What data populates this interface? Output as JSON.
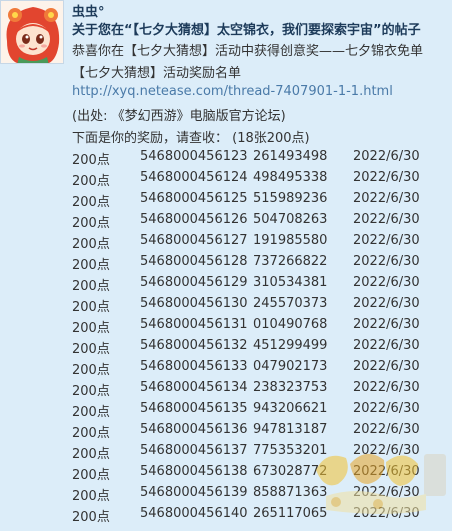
{
  "message": {
    "sender": "虫虫°",
    "title": "关于您在“【七夕大猜想】太空锦衣，我们要探索宇宙”的帖子",
    "line1": "恭喜你在【七夕大猜想】活动中获得创意奖——七夕锦衣免单",
    "line2": "【七夕大猜想】活动奖励名单",
    "link": "http://xyq.netease.com/thread-7407901-1-1.html",
    "source": "(出处: 《梦幻西游》电脑版官方论坛)",
    "reward_intro": "下面是你的奖励，请查收：  (18张200点)"
  },
  "rewards": [
    {
      "points": "200点",
      "card": "5468000456123",
      "password": "261493498",
      "date": "2022/6/30"
    },
    {
      "points": "200点",
      "card": "5468000456124",
      "password": "498495338",
      "date": "2022/6/30"
    },
    {
      "points": "200点",
      "card": "5468000456125",
      "password": "515989236",
      "date": "2022/6/30"
    },
    {
      "points": "200点",
      "card": "5468000456126",
      "password": "504708263",
      "date": "2022/6/30"
    },
    {
      "points": "200点",
      "card": "5468000456127",
      "password": "191985580",
      "date": "2022/6/30"
    },
    {
      "points": "200点",
      "card": "5468000456128",
      "password": "737266822",
      "date": "2022/6/30"
    },
    {
      "points": "200点",
      "card": "5468000456129",
      "password": "310534381",
      "date": "2022/6/30"
    },
    {
      "points": "200点",
      "card": "5468000456130",
      "password": "245570373",
      "date": "2022/6/30"
    },
    {
      "points": "200点",
      "card": "5468000456131",
      "password": "010490768",
      "date": "2022/6/30"
    },
    {
      "points": "200点",
      "card": "5468000456132",
      "password": "451299499",
      "date": "2022/6/30"
    },
    {
      "points": "200点",
      "card": "5468000456133",
      "password": "047902173",
      "date": "2022/6/30"
    },
    {
      "points": "200点",
      "card": "5468000456134",
      "password": "238323753",
      "date": "2022/6/30"
    },
    {
      "points": "200点",
      "card": "5468000456135",
      "password": "943206621",
      "date": "2022/6/30"
    },
    {
      "points": "200点",
      "card": "5468000456136",
      "password": "947813187",
      "date": "2022/6/30"
    },
    {
      "points": "200点",
      "card": "5468000456137",
      "password": "775353201",
      "date": "2022/6/30"
    },
    {
      "points": "200点",
      "card": "5468000456138",
      "password": "673028772",
      "date": "2022/6/30"
    },
    {
      "points": "200点",
      "card": "5468000456139",
      "password": "858871363",
      "date": "2022/6/30"
    },
    {
      "points": "200点",
      "card": "5468000456140",
      "password": "265117065",
      "date": "2022/6/30"
    }
  ],
  "icons": {
    "avatar": "cartoon-girl-avatar",
    "watermark": "site-logo-watermark"
  },
  "colors": {
    "background": "#dcedf9",
    "link": "#4a7aa8",
    "title": "#1d3b5a"
  }
}
